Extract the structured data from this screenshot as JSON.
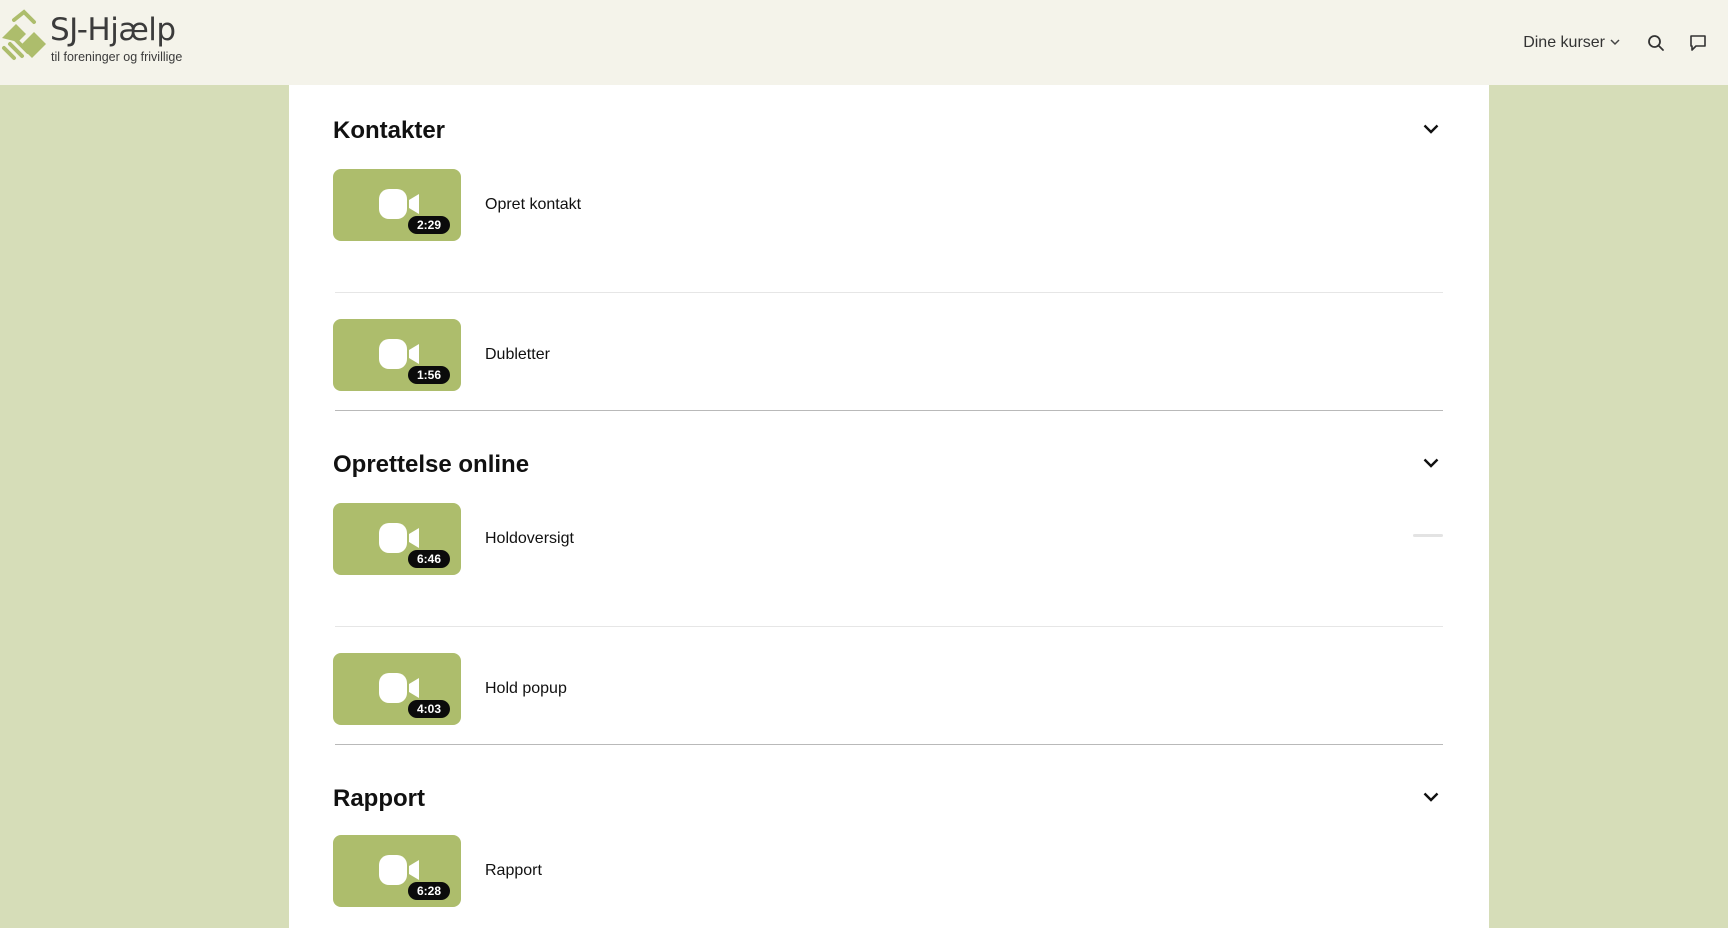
{
  "brand": {
    "title": "SJ-Hjælp",
    "subtitle": "til foreninger og frivillige",
    "accent": "#adbd6c",
    "background": "#d6ddb8",
    "header_bg": "#f4f3ea"
  },
  "nav": {
    "courses_label": "Dine kurser",
    "icons": [
      "chevron-down-icon",
      "search-icon",
      "chat-icon"
    ]
  },
  "sections": [
    {
      "title": "Kontakter",
      "lessons": [
        {
          "title": "Opret kontakt",
          "duration": "2:29",
          "icon": "video-camera-icon"
        },
        {
          "title": "Dubletter",
          "duration": "1:56",
          "icon": "video-camera-icon"
        }
      ]
    },
    {
      "title": "Oprettelse online",
      "lessons": [
        {
          "title": "Holdoversigt",
          "duration": "6:46",
          "icon": "video-camera-icon"
        },
        {
          "title": "Hold popup",
          "duration": "4:03",
          "icon": "video-camera-icon"
        }
      ]
    },
    {
      "title": "Rapport",
      "lessons": [
        {
          "title": "Rapport",
          "duration": "6:28",
          "icon": "video-camera-icon"
        }
      ]
    }
  ]
}
